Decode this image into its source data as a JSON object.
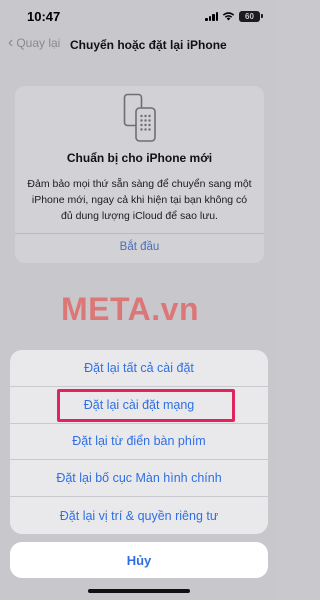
{
  "status_bar": {
    "time": "10:47",
    "battery": "60"
  },
  "nav": {
    "back_label": "Quay lại",
    "title": "Chuyển hoặc đặt lại iPhone"
  },
  "card": {
    "icon": "phones-icon",
    "title": "Chuẩn bị cho iPhone mới",
    "body": "Đảm bảo mọi thứ sẵn sàng để chuyển sang một iPhone mới, ngay cả khi hiện tại bạn không có đủ dung lượng iCloud để sao lưu.",
    "link": "Bắt đầu"
  },
  "watermark": "META.vn",
  "action_sheet": {
    "items": [
      {
        "label": "Đặt lại tất cả cài đặt"
      },
      {
        "label": "Đặt lại cài đặt mạng"
      },
      {
        "label": "Đặt lại từ điển bàn phím"
      },
      {
        "label": "Đặt lại bố cục Màn hình chính"
      },
      {
        "label": "Đặt lại vị trí & quyền riêng tư"
      }
    ],
    "cancel_label": "Hủy"
  },
  "colors": {
    "accent": "#2f6fe3",
    "highlight": "#e0245e",
    "watermark": "#e06a6a"
  }
}
